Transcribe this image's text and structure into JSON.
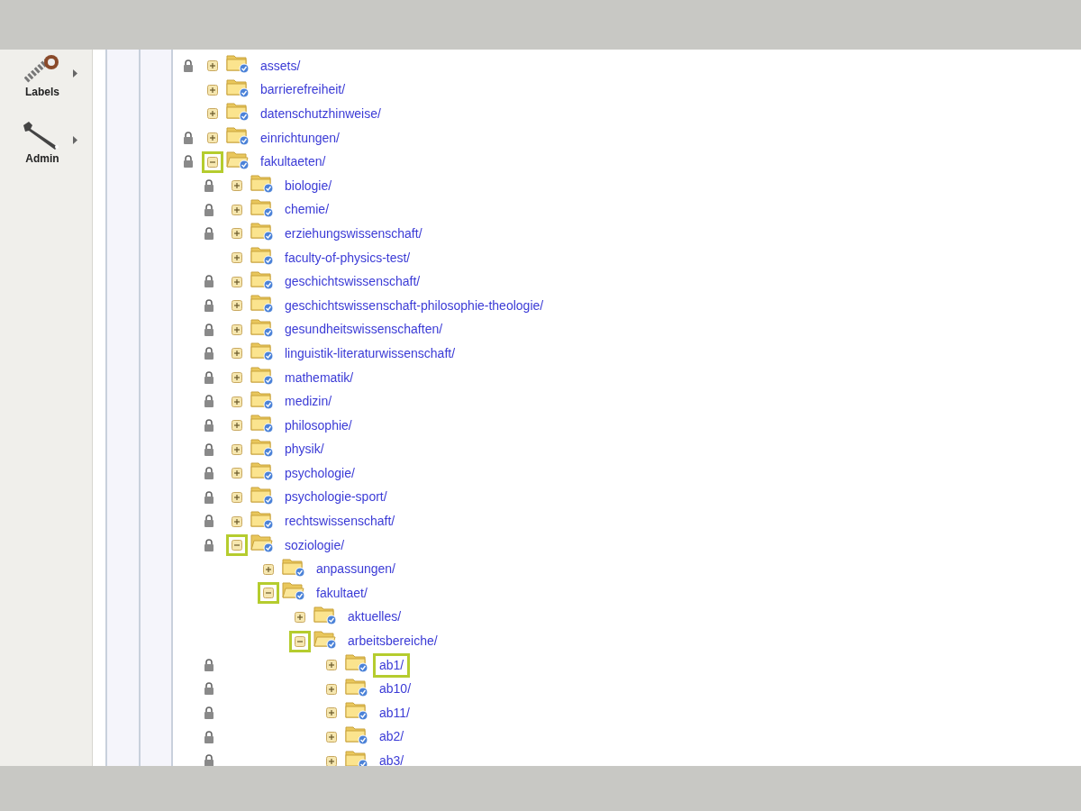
{
  "sidebar": {
    "items": [
      {
        "label": "Labels",
        "kind": "labels"
      },
      {
        "label": "Admin",
        "kind": "admin"
      }
    ]
  },
  "tree": [
    {
      "name": "assets/",
      "locked": true,
      "expanded": false,
      "selected": false
    },
    {
      "name": "barrierefreiheit/",
      "locked": false,
      "expanded": false,
      "selected": false
    },
    {
      "name": "datenschutzhinweise/",
      "locked": false,
      "expanded": false,
      "selected": false
    },
    {
      "name": "einrichtungen/",
      "locked": true,
      "expanded": false,
      "selected": false
    },
    {
      "name": "fakultaeten/",
      "locked": true,
      "expanded": true,
      "selected": false,
      "children": [
        {
          "name": "biologie/",
          "locked": true,
          "expanded": false,
          "selected": false
        },
        {
          "name": "chemie/",
          "locked": true,
          "expanded": false,
          "selected": false
        },
        {
          "name": "erziehungswissenschaft/",
          "locked": true,
          "expanded": false,
          "selected": false
        },
        {
          "name": "faculty-of-physics-test/",
          "locked": false,
          "expanded": false,
          "selected": false
        },
        {
          "name": "geschichtswissenschaft/",
          "locked": true,
          "expanded": false,
          "selected": false
        },
        {
          "name": "geschichtswissenschaft-philosophie-theologie/",
          "locked": true,
          "expanded": false,
          "selected": false
        },
        {
          "name": "gesundheitswissenschaften/",
          "locked": true,
          "expanded": false,
          "selected": false
        },
        {
          "name": "linguistik-literaturwissenschaft/",
          "locked": true,
          "expanded": false,
          "selected": false
        },
        {
          "name": "mathematik/",
          "locked": true,
          "expanded": false,
          "selected": false
        },
        {
          "name": "medizin/",
          "locked": true,
          "expanded": false,
          "selected": false
        },
        {
          "name": "philosophie/",
          "locked": true,
          "expanded": false,
          "selected": false
        },
        {
          "name": "physik/",
          "locked": true,
          "expanded": false,
          "selected": false
        },
        {
          "name": "psychologie/",
          "locked": true,
          "expanded": false,
          "selected": false
        },
        {
          "name": "psychologie-sport/",
          "locked": true,
          "expanded": false,
          "selected": false
        },
        {
          "name": "rechtswissenschaft/",
          "locked": true,
          "expanded": false,
          "selected": false
        },
        {
          "name": "soziologie/",
          "locked": true,
          "expanded": true,
          "selected": false,
          "children": [
            {
              "name": "anpassungen/",
              "locked": false,
              "expanded": false,
              "selected": false
            },
            {
              "name": "fakultaet/",
              "locked": false,
              "expanded": true,
              "selected": false,
              "children": [
                {
                  "name": "aktuelles/",
                  "locked": false,
                  "expanded": false,
                  "selected": false
                },
                {
                  "name": "arbeitsbereiche/",
                  "locked": false,
                  "expanded": true,
                  "selected": false,
                  "children": [
                    {
                      "name": "ab1/",
                      "locked": true,
                      "expanded": false,
                      "selected": true
                    },
                    {
                      "name": "ab10/",
                      "locked": true,
                      "expanded": false,
                      "selected": false
                    },
                    {
                      "name": "ab11/",
                      "locked": true,
                      "expanded": false,
                      "selected": false
                    },
                    {
                      "name": "ab2/",
                      "locked": true,
                      "expanded": false,
                      "selected": false
                    },
                    {
                      "name": "ab3/",
                      "locked": true,
                      "expanded": false,
                      "selected": false
                    }
                  ]
                }
              ]
            }
          ]
        }
      ]
    }
  ]
}
